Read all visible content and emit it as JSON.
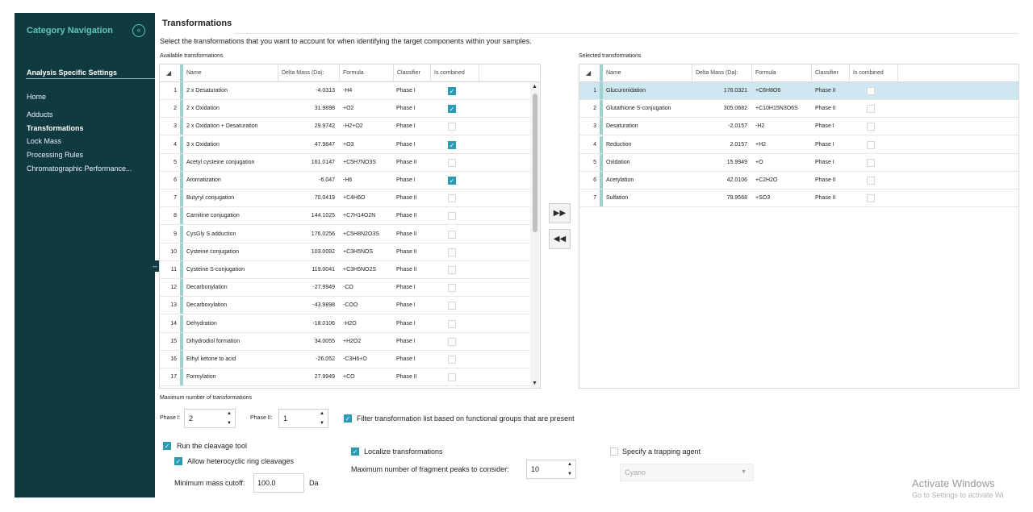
{
  "sidebar": {
    "header": "Category Navigation",
    "collapse_icon": "chevrons-left-icon",
    "section": "Analysis Specific Settings",
    "items": [
      {
        "label": "Home",
        "active": false
      },
      {
        "label": "Adducts",
        "active": false
      },
      {
        "label": "Transformations",
        "active": true
      },
      {
        "label": "Lock Mass",
        "active": false
      },
      {
        "label": "Processing Rules",
        "active": false
      },
      {
        "label": "Chromatographic Performance...",
        "active": false
      }
    ],
    "expander_icon": "resize-horizontal-icon"
  },
  "page": {
    "title": "Transformations",
    "subtitle": "Select the transformations that you want to account for when identifying the target components within your samples."
  },
  "available": {
    "label": "Available transformations",
    "columns": {
      "name": "Name",
      "delta": "Delta Mass (Da):",
      "formula": "Formula",
      "classifier": "Classifier",
      "combined": "Is combined"
    },
    "rows": [
      {
        "n": "1",
        "name": "2 x Desaturation",
        "delta": "-4.0313",
        "formula": "-H4",
        "classifier": "Phase I",
        "combined": true
      },
      {
        "n": "2",
        "name": "2 x Oxidation",
        "delta": "31.9898",
        "formula": "+O2",
        "classifier": "Phase I",
        "combined": true
      },
      {
        "n": "3",
        "name": "2 x Oxidation + Desaturation",
        "delta": "29.9742",
        "formula": "-H2+O2",
        "classifier": "Phase I",
        "combined": false
      },
      {
        "n": "4",
        "name": "3 x Oxidation",
        "delta": "47.9847",
        "formula": "+O3",
        "classifier": "Phase I",
        "combined": true
      },
      {
        "n": "5",
        "name": "Acetyl cysteine conjugation",
        "delta": "161.0147",
        "formula": "+C5H7NO3S",
        "classifier": "Phase II",
        "combined": false
      },
      {
        "n": "6",
        "name": "Aromatization",
        "delta": "-6.047",
        "formula": "-H6",
        "classifier": "Phase I",
        "combined": true
      },
      {
        "n": "7",
        "name": "Butyryl conjugation",
        "delta": "70.0419",
        "formula": "+C4H6O",
        "classifier": "Phase II",
        "combined": false
      },
      {
        "n": "8",
        "name": "Carnitine conjugation",
        "delta": "144.1025",
        "formula": "+C7H14O2N",
        "classifier": "Phase II",
        "combined": false
      },
      {
        "n": "9",
        "name": "CysGly S adduction",
        "delta": "176.0256",
        "formula": "+C5H8N2O3S",
        "classifier": "Phase II",
        "combined": false
      },
      {
        "n": "10",
        "name": "Cysteine conjugation",
        "delta": "103.0092",
        "formula": "+C3H5NOS",
        "classifier": "Phase II",
        "combined": false
      },
      {
        "n": "11",
        "name": "Cysteine S-conjugation",
        "delta": "119.0041",
        "formula": "+C3H5NO2S",
        "classifier": "Phase II",
        "combined": false
      },
      {
        "n": "12",
        "name": "Decarbonylation",
        "delta": "-27.9949",
        "formula": "-CO",
        "classifier": "Phase I",
        "combined": false
      },
      {
        "n": "13",
        "name": "Decarboxylation",
        "delta": "-43.9898",
        "formula": "-COO",
        "classifier": "Phase I",
        "combined": false
      },
      {
        "n": "14",
        "name": "Dehydration",
        "delta": "-18.0106",
        "formula": "-H2O",
        "classifier": "Phase I",
        "combined": false
      },
      {
        "n": "15",
        "name": "Dihydrodiol formation",
        "delta": "34.0055",
        "formula": "+H2O2",
        "classifier": "Phase I",
        "combined": false
      },
      {
        "n": "16",
        "name": "Ethyl ketone to acid",
        "delta": "-26.052",
        "formula": "-C3H6+O",
        "classifier": "Phase I",
        "combined": false
      },
      {
        "n": "17",
        "name": "Formylation",
        "delta": "27.9949",
        "formula": "+CO",
        "classifier": "Phase II",
        "combined": false
      }
    ]
  },
  "selected": {
    "label": "Selected transformations",
    "columns": {
      "name": "Name",
      "delta": "Delta Mass (Da):",
      "formula": "Formula",
      "classifier": "Classifier",
      "combined": "Is combined"
    },
    "rows": [
      {
        "n": "1",
        "name": "Glucuronidation",
        "delta": "176.0321",
        "formula": "+C6H8O6",
        "classifier": "Phase II",
        "combined": false
      },
      {
        "n": "2",
        "name": "Glutathione S-conjugation",
        "delta": "305.0682",
        "formula": "+C10H15N3O6S",
        "classifier": "Phase II",
        "combined": false
      },
      {
        "n": "3",
        "name": "Desaturation",
        "delta": "-2.0157",
        "formula": "-H2",
        "classifier": "Phase I",
        "combined": false
      },
      {
        "n": "4",
        "name": "Reduction",
        "delta": "2.0157",
        "formula": "+H2",
        "classifier": "Phase I",
        "combined": false
      },
      {
        "n": "5",
        "name": "Oxidation",
        "delta": "15.9949",
        "formula": "+O",
        "classifier": "Phase I",
        "combined": false
      },
      {
        "n": "6",
        "name": "Acetylation",
        "delta": "42.0106",
        "formula": "+C2H2O",
        "classifier": "Phase II",
        "combined": false
      },
      {
        "n": "7",
        "name": "Sulfation",
        "delta": "79.9568",
        "formula": "+SO3",
        "classifier": "Phase II",
        "combined": false
      }
    ]
  },
  "move": {
    "add_all_icon": "double-chevron-right-icon",
    "remove_all_icon": "double-chevron-left-icon"
  },
  "max_transformations": {
    "label": "Maximum number of transformations",
    "phase1_label": "Phase I:",
    "phase1_value": "2",
    "phase2_label": "Phase II:",
    "phase2_value": "1"
  },
  "filter_functional": {
    "label": "Filter transformation list based on functional groups that are present",
    "checked": true
  },
  "cleavage": {
    "run_label": "Run the cleavage tool",
    "run_checked": true,
    "hetero_label": "Allow heterocyclic ring cleavages",
    "hetero_checked": true,
    "cutoff_label": "Minimum mass cutoff:",
    "cutoff_value": "100.0",
    "cutoff_unit": "Da"
  },
  "localize": {
    "label": "Localize transformations",
    "checked": true,
    "peaks_label": "Maximum number of fragment peaks to consider:",
    "peaks_value": "10"
  },
  "trapping": {
    "label": "Specify a trapping agent",
    "checked": false,
    "agent": "Cyano"
  },
  "watermark": {
    "line1": "Activate Windows",
    "line2": "Go to Settings to activate Wi"
  },
  "colors": {
    "accent": "#2b9bb3",
    "sidebar_bg": "#0f3b40",
    "sidebar_header": "#5fc6b5",
    "selected_row": "#cfe7f0"
  }
}
